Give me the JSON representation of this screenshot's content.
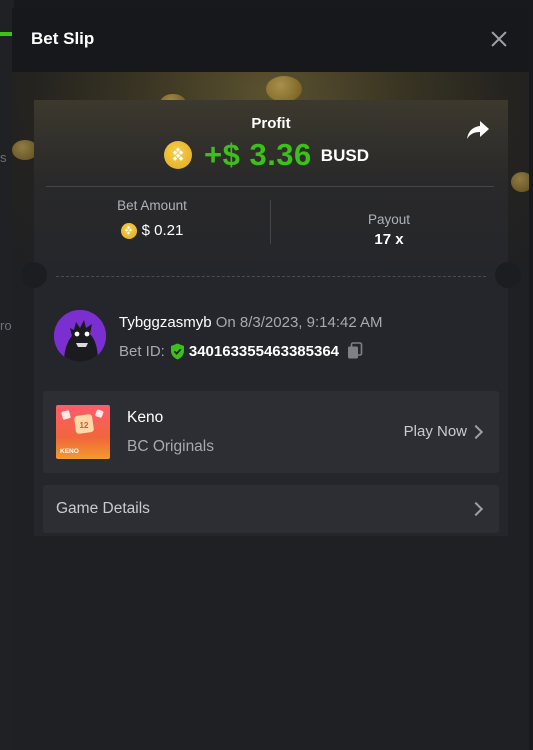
{
  "background": {
    "side_text_1": "s",
    "side_text_2": "ro"
  },
  "modal": {
    "title": "Bet Slip",
    "close_icon": "close-icon"
  },
  "profit": {
    "label": "Profit",
    "amount": "+$ 3.36",
    "currency": "BUSD",
    "coin_icon": "busd-coin-icon",
    "share_icon": "share-icon"
  },
  "stats": {
    "bet_amount_label": "Bet Amount",
    "bet_amount_value": "$ 0.21",
    "payout_label": "Payout",
    "payout_value": "17 x"
  },
  "user": {
    "name": "Tybggzasmyb",
    "on_label": "On",
    "datetime": "8/3/2023, 9:14:42 AM",
    "bet_id_label": "Bet ID:",
    "bet_id": "340163355463385364"
  },
  "game": {
    "name": "Keno",
    "provider": "BC Originals",
    "thumb_label": "KENO",
    "thumb_ball": "12",
    "play_label": "Play Now"
  },
  "details": {
    "label": "Game Details"
  },
  "colors": {
    "accent_green": "#3bc117",
    "coin_gold": "#f6c92e",
    "modal_bg": "#1f2024",
    "card_bg": "#25262b"
  }
}
